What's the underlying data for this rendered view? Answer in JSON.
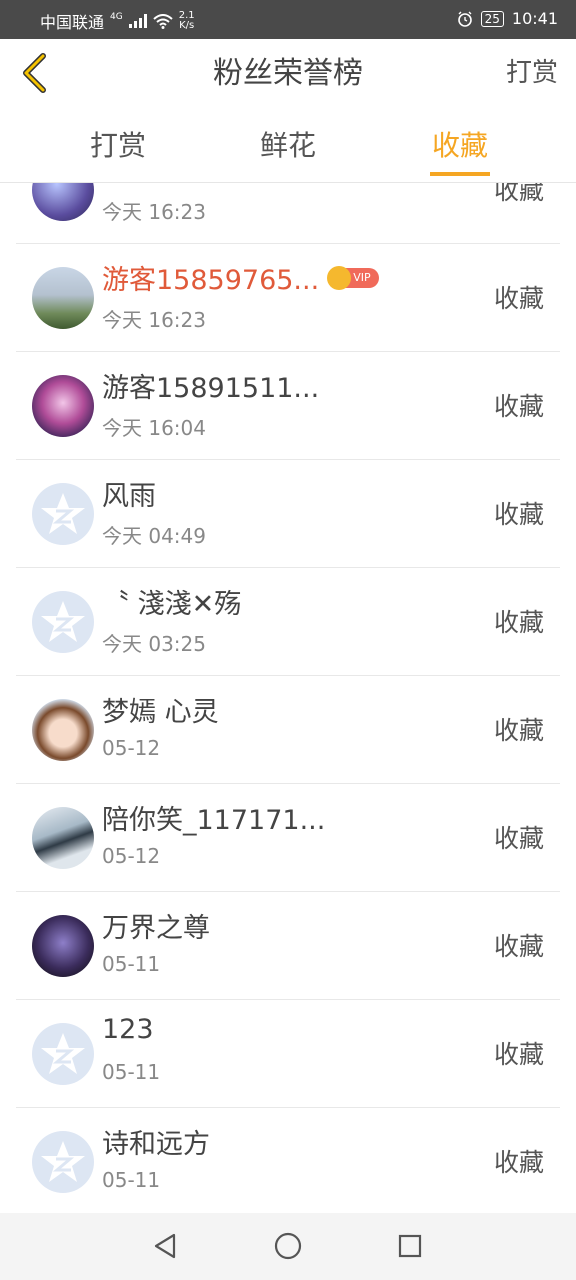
{
  "status_bar": {
    "carrier": "中国联通",
    "network": "4G",
    "speed_value": "2.1",
    "speed_unit": "K/s",
    "battery": "25",
    "time": "10:41"
  },
  "header": {
    "title": "粉丝荣誉榜",
    "action_label": "打赏"
  },
  "tabs": [
    {
      "label": "打赏",
      "active": false
    },
    {
      "label": "鲜花",
      "active": false
    },
    {
      "label": "收藏",
      "active": true
    }
  ],
  "rows": [
    {
      "name": "…",
      "time": "今天 16:23",
      "action": "收藏",
      "vip": false,
      "avatar": "anime-purple-avatar"
    },
    {
      "name": "游客15859765...",
      "time": "今天 16:23",
      "action": "收藏",
      "vip": true,
      "vip_label": "VIP",
      "avatar": "photo-green-avatar"
    },
    {
      "name": "游客15891511...",
      "time": "今天 16:04",
      "action": "收藏",
      "vip": false,
      "avatar": "anime-pink-avatar"
    },
    {
      "name": "风雨",
      "time": "今天 04:49",
      "action": "收藏",
      "vip": false,
      "avatar": "default-avatar"
    },
    {
      "name": "〝 淺淺✕殇",
      "time": "今天 03:25",
      "action": "收藏",
      "vip": false,
      "avatar": "default-avatar"
    },
    {
      "name": "梦嫣 心灵",
      "time": "05-12",
      "action": "收藏",
      "vip": false,
      "avatar": "doll-avatar"
    },
    {
      "name": "陪你笑_117171...",
      "time": "05-12",
      "action": "收藏",
      "vip": false,
      "avatar": "photo-boy-avatar"
    },
    {
      "name": "万界之尊",
      "time": "05-11",
      "action": "收藏",
      "vip": false,
      "avatar": "anime-dark-avatar"
    },
    {
      "name": "123",
      "time": "05-11",
      "action": "收藏",
      "vip": false,
      "avatar": "default-avatar"
    },
    {
      "name": "诗和远方",
      "time": "05-11",
      "action": "收藏",
      "vip": false,
      "avatar": "default-avatar"
    }
  ],
  "colors": {
    "accent": "#f5a623",
    "vip_name": "#e05a3a",
    "default_avatar_bg": "#dde6f3"
  }
}
